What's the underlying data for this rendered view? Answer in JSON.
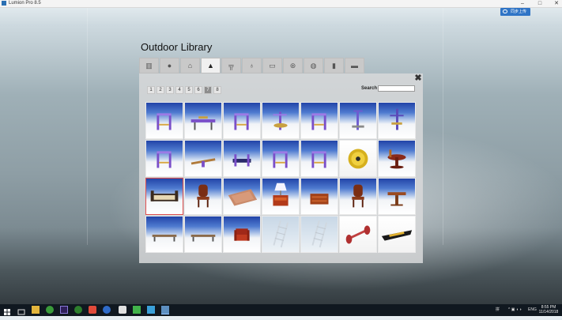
{
  "window": {
    "title": "Lumion Pro 8.5",
    "minimize": "–",
    "maximize": "□",
    "close": "✕"
  },
  "share_button": {
    "label": "同步上传"
  },
  "library": {
    "title": "Outdoor Library",
    "tabs": [
      "fence-icon",
      "sphere-icon",
      "house-icon",
      "hill-icon",
      "bench-icon",
      "lamp-icon",
      "sofa-icon",
      "gear-circle-icon",
      "leaf-icon",
      "bin-icon",
      "tray-icon"
    ],
    "active_tab_index": 3,
    "close_label": "✖",
    "pages": [
      "1",
      "2",
      "3",
      "4",
      "5",
      "6",
      "7",
      "8"
    ],
    "active_page": "7",
    "search_label": "Search",
    "search_value": "",
    "items": [
      {
        "kind": "bars"
      },
      {
        "kind": "bench"
      },
      {
        "kind": "bars"
      },
      {
        "kind": "twist"
      },
      {
        "kind": "bars"
      },
      {
        "kind": "stepper"
      },
      {
        "kind": "tower"
      },
      {
        "kind": "bars"
      },
      {
        "kind": "seesaw"
      },
      {
        "kind": "press"
      },
      {
        "kind": "bars"
      },
      {
        "kind": "bars"
      },
      {
        "kind": "disc"
      },
      {
        "kind": "table-round"
      },
      {
        "kind": "daybed"
      },
      {
        "kind": "chair-wood"
      },
      {
        "kind": "rug"
      },
      {
        "kind": "cabinet-lamp"
      },
      {
        "kind": "drawer"
      },
      {
        "kind": "chair-wood"
      },
      {
        "kind": "side-table"
      },
      {
        "kind": "low-table"
      },
      {
        "kind": "low-table"
      },
      {
        "kind": "armchair"
      },
      {
        "kind": "ladder"
      },
      {
        "kind": "ladder"
      },
      {
        "kind": "dumbbell"
      },
      {
        "kind": "boat"
      }
    ],
    "selected_index": 14
  },
  "taskbar": {
    "apps": [
      "windows-icon",
      "search-icon",
      "task-view-icon",
      "file-explorer-icon",
      "chrome-icon",
      "photoshop-icon",
      "app-green-icon",
      "app-red-icon",
      "app-blue-icon",
      "app-green2-icon",
      "lumion-icon"
    ],
    "tray_lang": "ENG",
    "tray_ime": "拼",
    "time": "8:55 PM",
    "date": "11/14/2018"
  }
}
